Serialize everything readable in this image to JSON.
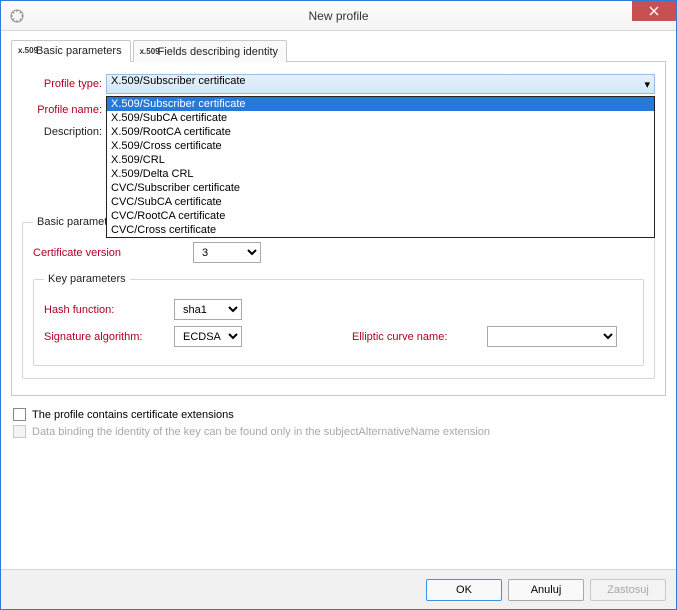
{
  "window": {
    "title": "New profile"
  },
  "tabs": {
    "basic": {
      "label": "Basic parameters",
      "icon": "x.509"
    },
    "identity": {
      "label": "Fields describing identity",
      "icon": "x.509 sub"
    }
  },
  "form": {
    "profile_type_label": "Profile type:",
    "profile_type_value": "X.509/Subscriber certificate",
    "profile_name_label": "Profile name:",
    "description_label": "Description:"
  },
  "dropdown": {
    "items": [
      "X.509/Subscriber certificate",
      "X.509/SubCA certificate",
      "X.509/RootCA certificate",
      "X.509/Cross certificate",
      "X.509/CRL",
      "X.509/Delta CRL",
      "CVC/Subscriber certificate",
      "CVC/SubCA certificate",
      "CVC/RootCA certificate",
      "CVC/Cross certificate"
    ],
    "selected_index": 0
  },
  "basic_params": {
    "legend": "Basic parameters",
    "cert_version_label": "Certificate version",
    "cert_version_value": "3",
    "key_params_legend": "Key parameters",
    "hash_label": "Hash function:",
    "hash_value": "sha1",
    "sig_label": "Signature algorithm:",
    "sig_value": "ECDSA",
    "ecurve_label": "Elliptic curve name:"
  },
  "checks": {
    "ext_label": "The profile contains certificate extensions",
    "databind_label": "Data binding the identity of the key can be found only in the subjectAlternativeName extension"
  },
  "buttons": {
    "ok": "OK",
    "cancel": "Anuluj",
    "apply": "Zastosuj"
  }
}
